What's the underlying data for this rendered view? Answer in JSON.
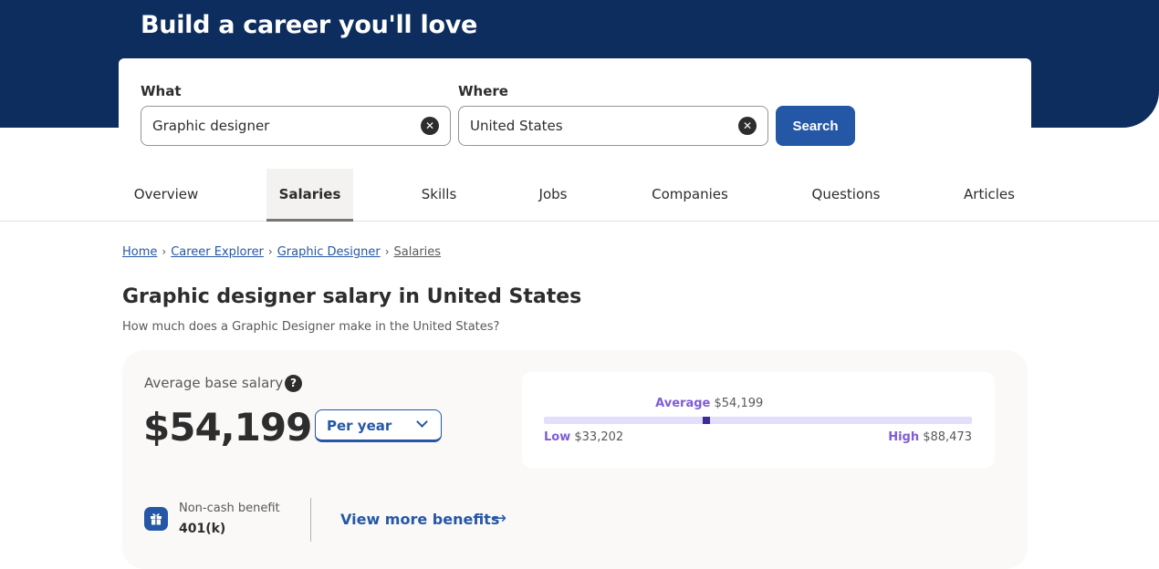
{
  "hero": {
    "title": "Build a career you'll love"
  },
  "search": {
    "what_label": "What",
    "what_value": "Graphic designer",
    "where_label": "Where",
    "where_value": "United States",
    "clear_glyph": "✕",
    "search_button": "Search"
  },
  "tabs": [
    {
      "label": "Overview",
      "active": false
    },
    {
      "label": "Salaries",
      "active": true
    },
    {
      "label": "Skills",
      "active": false
    },
    {
      "label": "Jobs",
      "active": false
    },
    {
      "label": "Companies",
      "active": false
    },
    {
      "label": "Questions",
      "active": false
    },
    {
      "label": "Articles",
      "active": false
    }
  ],
  "breadcrumb": {
    "items": [
      "Home",
      "Career Explorer",
      "Graphic Designer",
      "Salaries"
    ],
    "separator": "›"
  },
  "page": {
    "title": "Graphic designer salary in United States",
    "subtitle": "How much does a Graphic Designer make in the United States?"
  },
  "salary": {
    "avg_label": "Average base salary",
    "help_glyph": "?",
    "avg_value": "$54,199",
    "period": "Per year",
    "range": {
      "average_label": "Average",
      "average_value": "$54,199",
      "low_label": "Low",
      "low_value": "$33,202",
      "high_label": "High",
      "high_value": "$88,473",
      "average_fraction": 0.38
    },
    "benefit_label": "Non-cash benefit",
    "benefit_value": "401(k)",
    "more_link": "View more benefits",
    "arrow_glyph": "→"
  },
  "colors": {
    "brand_navy": "#0d2d5e",
    "accent_blue": "#2557a7",
    "range_purple": "#7e5cdb",
    "marker": "#3a2b99"
  }
}
